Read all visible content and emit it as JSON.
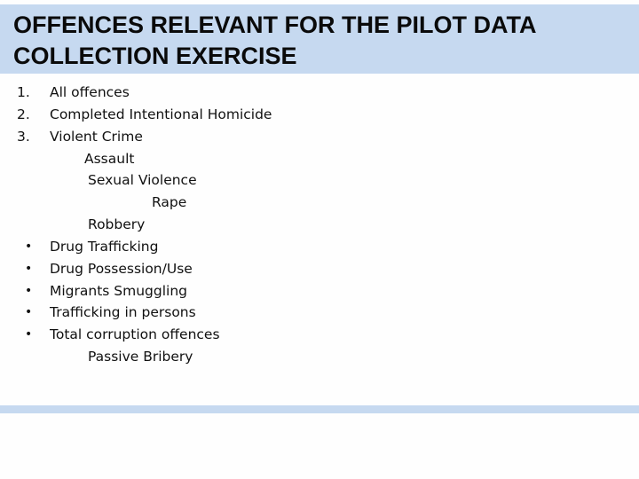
{
  "slide": {
    "title": "OFFENCES RELEVANT FOR THE PILOT DATA COLLECTION EXERCISE",
    "colors": {
      "title_band": "#c6d9f0",
      "bottom_band": "#c6d9f0",
      "text": "#111111"
    },
    "items": [
      {
        "marker": "1.",
        "text": "All offences"
      },
      {
        "marker": "2.",
        "text": "Completed Intentional Homicide"
      },
      {
        "marker": "3.",
        "text": "Violent Crime"
      },
      {
        "marker": "",
        "text": "Assault"
      },
      {
        "marker": "",
        "text": "Sexual Violence"
      },
      {
        "marker": "",
        "text": "Rape"
      },
      {
        "marker": "",
        "text": "Robbery"
      },
      {
        "marker": "•",
        "text": "Drug Trafficking"
      },
      {
        "marker": "•",
        "text": "Drug Possession/Use"
      },
      {
        "marker": "•",
        "text": "Migrants Smuggling"
      },
      {
        "marker": "•",
        "text": "Trafficking in persons"
      },
      {
        "marker": "•",
        "text": "Total corruption offences"
      },
      {
        "marker": "",
        "text": "Passive Bribery"
      }
    ]
  }
}
